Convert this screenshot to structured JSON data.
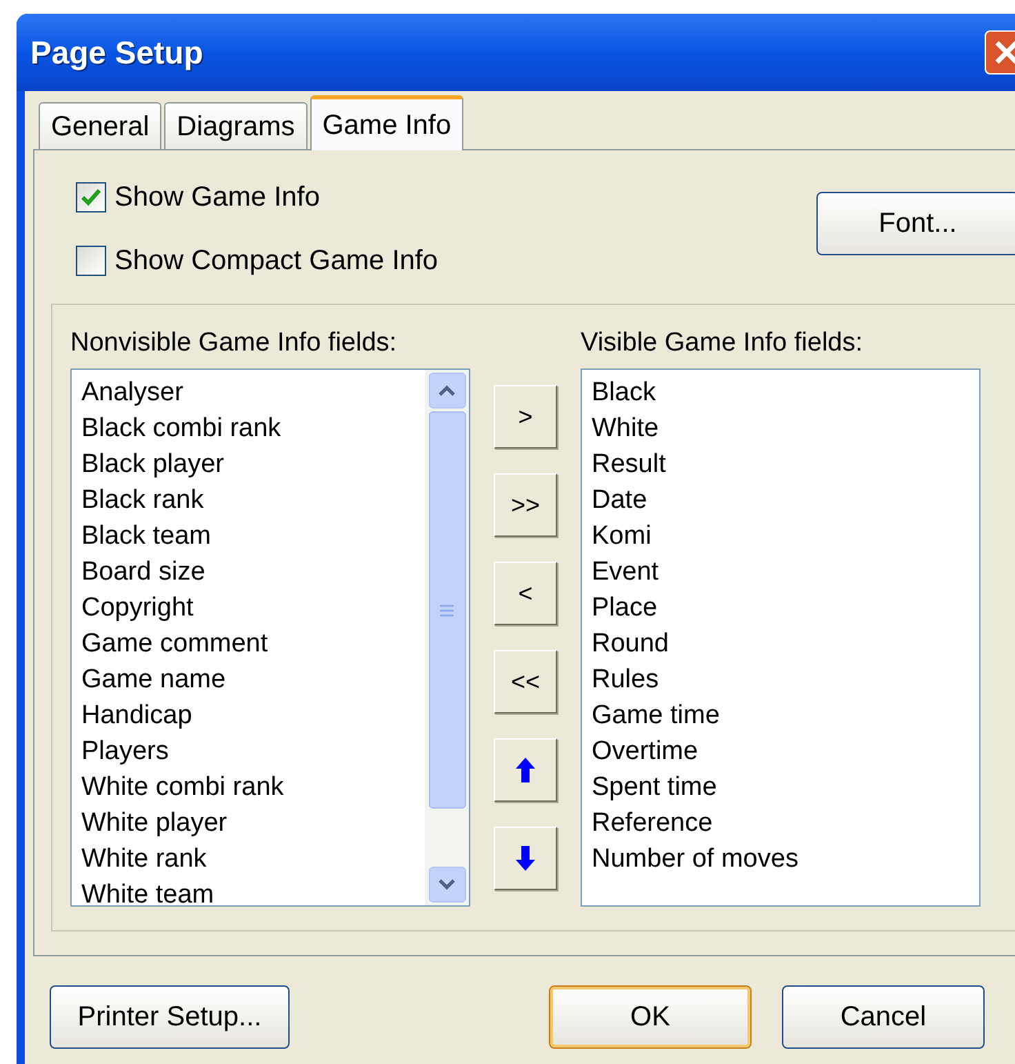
{
  "window": {
    "title": "Page Setup"
  },
  "tabs": [
    {
      "label": "General",
      "selected": false
    },
    {
      "label": "Diagrams",
      "selected": false
    },
    {
      "label": "Game Info",
      "selected": true
    }
  ],
  "options": [
    {
      "label": "Show Game Info",
      "checked": true
    },
    {
      "label": "Show Compact Game Info",
      "checked": false
    }
  ],
  "font_button": "Font...",
  "nonvisible": {
    "label": "Nonvisible Game Info fields:",
    "items": [
      "Analyser",
      "Black combi rank",
      "Black player",
      "Black rank",
      "Black team",
      "Board size",
      "Copyright",
      "Game comment",
      "Game name",
      "Handicap",
      "Players",
      "White combi rank",
      "White player",
      "White rank",
      "White team"
    ]
  },
  "move_buttons": [
    {
      "kind": "text",
      "label": ">"
    },
    {
      "kind": "text",
      "label": ">>"
    },
    {
      "kind": "text",
      "label": "<"
    },
    {
      "kind": "text",
      "label": "<<"
    },
    {
      "kind": "up"
    },
    {
      "kind": "down"
    }
  ],
  "visible": {
    "label": "Visible Game Info fields:",
    "items": [
      "Black",
      "White",
      "Result",
      "Date",
      "Komi",
      "Event",
      "Place",
      "Round",
      "Rules",
      "Game time",
      "Overtime",
      "Spent time",
      "Reference",
      "Number of moves"
    ]
  },
  "buttons": [
    {
      "label": "Printer Setup...",
      "default": false
    },
    {
      "label": "OK",
      "default": true
    },
    {
      "label": "Cancel",
      "default": false
    }
  ]
}
